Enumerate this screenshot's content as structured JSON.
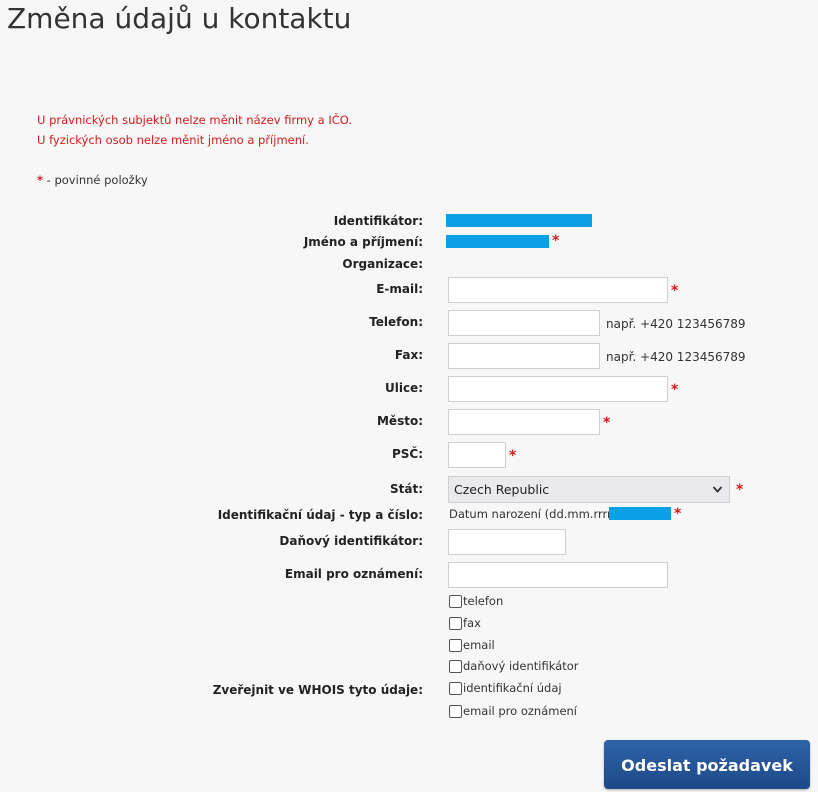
{
  "page": {
    "title": "Změna údajů u kontaktu"
  },
  "warnings": [
    "U právnických subjektů nelze měnit název firmy a IČO.",
    "U fyzických osob nelze měnit jméno a příjmení."
  ],
  "required_note": {
    "star": "*",
    "text": " - povinné položky"
  },
  "labels": {
    "identifikator": "Identifikátor:",
    "jmeno": "Jméno a příjmení:",
    "organizace": "Organizace:",
    "email": "E-mail:",
    "telefon": "Telefon:",
    "fax": "Fax:",
    "ulice": "Ulice:",
    "mesto": "Město:",
    "psc": "PSČ:",
    "stat": "Stát:",
    "ident_udaj": "Identifikační údaj - typ a číslo:",
    "danovy": "Daňový identifikátor:",
    "email_oznameni": "Email pro oznámení:",
    "whois": "Zveřejnit ve WHOIS tyto údaje:"
  },
  "fields": {
    "email": "",
    "telefon": "",
    "fax": "",
    "ulice": "",
    "mesto": "",
    "psc": "",
    "danovy": "",
    "email_oznameni": ""
  },
  "hints": {
    "telefon": "např. +420 123456789",
    "fax": "např. +420 123456789"
  },
  "required_mark": "*",
  "country": {
    "selected": "Czech Republic"
  },
  "ident_udaj": {
    "type_text": "Datum narození (dd.mm.rrrr):"
  },
  "whois_options": [
    {
      "label": "telefon",
      "checked": false
    },
    {
      "label": "fax",
      "checked": false
    },
    {
      "label": "email",
      "checked": false
    },
    {
      "label": "daňový identifikátor",
      "checked": false
    },
    {
      "label": "identifikační údaj",
      "checked": false
    },
    {
      "label": "email pro oznámení",
      "checked": false
    }
  ],
  "submit": {
    "label": "Odeslat požadavek"
  },
  "colors": {
    "redacted": "#0aa0e3",
    "required": "#d21a1a",
    "button": "#23508f"
  }
}
